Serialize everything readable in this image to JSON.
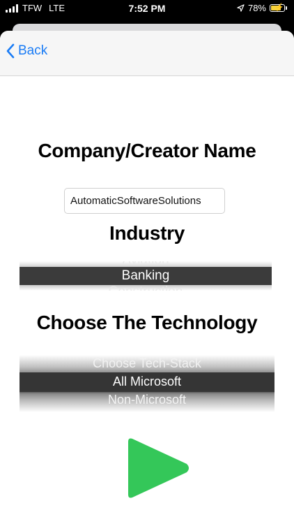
{
  "status_bar": {
    "carrier": "TFW",
    "network": "LTE",
    "time": "7:52 PM",
    "battery_percent": "78%",
    "battery_level": 0.78,
    "battery_color": "#f7d23a"
  },
  "nav": {
    "back_label": "Back",
    "accent_color": "#1a7cf5"
  },
  "company": {
    "heading": "Company/Creator Name",
    "input_value": "AutomaticSoftwareSolutions"
  },
  "industry": {
    "heading": "Industry",
    "options_visible": [
      "Aviation",
      "Banking",
      "Construction"
    ],
    "selected": "Banking"
  },
  "technology": {
    "heading": "Choose The Technology",
    "options_visible": [
      "Choose Tech-Stack",
      "All Microsoft",
      "Non-Microsoft"
    ],
    "selected": "All Microsoft"
  },
  "play": {
    "icon": "play-icon",
    "color": "#34c759"
  }
}
